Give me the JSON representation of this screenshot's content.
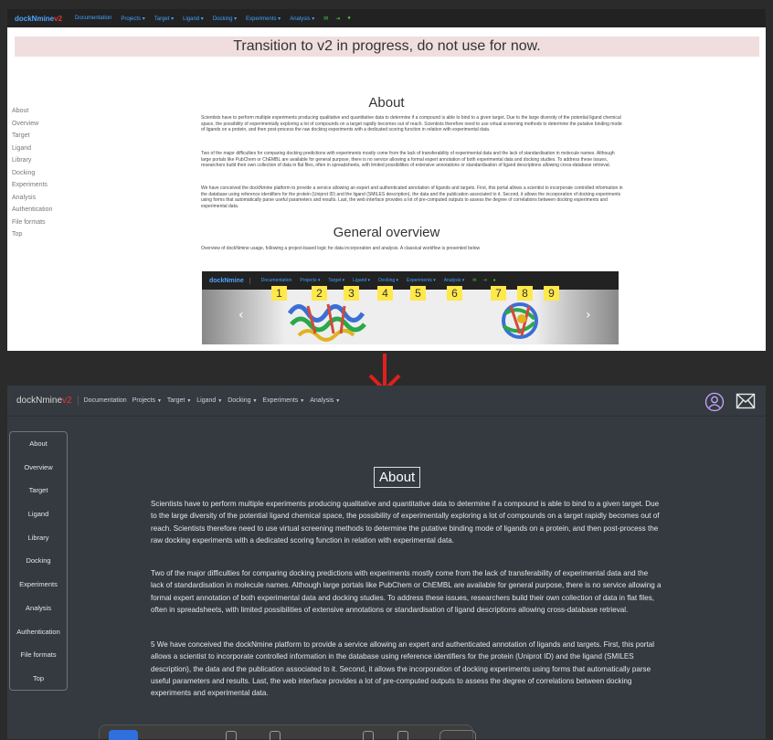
{
  "old_site": {
    "brand": "dockNmine",
    "brand_version": "v2",
    "nav_items": [
      "Documentation",
      "Projects ▾",
      "Target ▾",
      "Ligand ▾",
      "Docking ▾",
      "Experiments ▾",
      "Analysis ▾"
    ],
    "banner": "Transition to v2 in progress, do not use for now.",
    "sidebar": [
      "About",
      "Overview",
      "Target",
      "Ligand",
      "Library",
      "Docking",
      "Experiments",
      "Analysis",
      "Authentication",
      "File formats",
      "Top"
    ],
    "about_title": "About",
    "paragraphs": [
      "Scientists have to perform multiple experiments producing qualitative and quantitative data to determine if a compound is able to bind to a given target. Due to the large diversity of the potential ligand chemical space, the possibility of experimentally exploring a lot of compounds on a target rapidly becomes out of reach. Scientists therefore need to use virtual screening methods to determine the putative binding mode of ligands on a protein, and then post-process the raw docking experiments with a dedicated scoring function in relation with experimental data.",
      "Two of the major difficulties for comparing docking predictions with experiments mostly come from the lack of transferability of experimental data and the lack of standardisation in molecule names. Although large portals like PubChem or ChEMBL are available for general purpose, there is no service allowing a formal expert annotation of both experimental data and docking studies. To address these issues, researchers build their own collection of data in flat files, often in spreadsheets, with limited possibilities of extensive annotations or standardisation of ligand descriptions allowing cross-database retrieval.",
      "We have conceived the dockNmine platform to provide a service allowing an expert and authenticated annotation of ligands and targets. First, this portal allows a scientist to incorporate controlled information in the database using reference identifiers for the protein (Uniprot ID) and the ligand (SMILES description), the data and the publication associated to it. Second, it allows the incorporation of docking experiments using forms that automatically parse useful parameters and results. Last, the web interface provides a lot of pre-computed outputs to assess the degree of correlations between docking experiments and experimental data."
    ],
    "overview_title": "General overview",
    "overview_text": "Overview of dockNmine usage, following a project-based logic for data incorporation and analysis. A classical workflow is presented below",
    "carousel": {
      "brand": "dockNmine",
      "nav_items": [
        "Documentation",
        "Projects ▾",
        "Target ▾",
        "Ligand ▾",
        "Docking ▾",
        "Experiments ▾",
        "Analysis ▾"
      ],
      "numbers": [
        "1",
        "2",
        "3",
        "4",
        "5",
        "6",
        "7",
        "8",
        "9"
      ],
      "prev": "‹",
      "next": "›"
    }
  },
  "new_site": {
    "brand": "dockNmine",
    "brand_version": "v2",
    "nav_items": [
      "Documentation",
      "Projects",
      "Target",
      "Ligand",
      "Docking",
      "Experiments",
      "Analysis"
    ],
    "sidebar": [
      "About",
      "Overview",
      "Target",
      "Ligand",
      "Library",
      "Docking",
      "Experiments",
      "Analysis",
      "Authentication",
      "File formats",
      "Top"
    ],
    "about_title": "About",
    "paragraphs": [
      "Scientists have to perform multiple experiments producing qualitative and quantitative data to determine if a compound is able to bind to a given target. Due to the large diversity of the potential ligand chemical space, the possibility of experimentally exploring a lot of compounds on a target rapidly becomes out of reach. Scientists therefore need to use virtual screening methods to determine the putative binding mode of ligands on a protein, and then post-process the raw docking experiments with a dedicated scoring function in relation with experimental data.",
      "Two of the major difficulties for comparing docking predictions with experiments mostly come from the lack of transferability of experimental data and the lack of standardisation in molecule names. Although large portals like PubChem or ChEMBL are available for general purpose, there is no service allowing a formal expert annotation of both experimental data and docking studies. To address these issues, researchers build their own collection of data in flat files, often in spreadsheets, with limited possibilities of extensive annotations or standardisation of ligand descriptions allowing cross-database retrieval.",
      "5 We have conceived the dockNmine platform to provide a service allowing an expert and authenticated annotation of ligands and targets. First, this portal allows a scientist to incorporate controlled information in the database using reference identifiers for the protein (Uniprot ID) and the ligand (SMILES description), the data and the publication associated to it. Second, it allows the incorporation of docking experiments using forms that automatically parse useful parameters and results. Last, the web interface provides a lot of pre-computed outputs to assess the degree of correlations between docking experiments and experimental data."
    ]
  },
  "colors": {
    "arrow": "#e0201c",
    "accent_red": "#e33333",
    "dark_bg": "#343a40",
    "highlight": "#ffe84a"
  }
}
